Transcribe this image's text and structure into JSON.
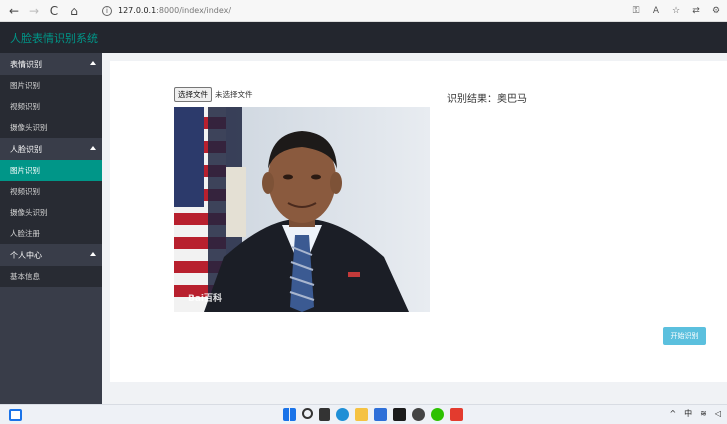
{
  "browser": {
    "url_host": "127.0.0.1",
    "url_path": ":8000/index/index/",
    "back_icon": "←",
    "forward_icon": "→",
    "reload_icon": "C",
    "home_icon": "⌂"
  },
  "header": {
    "title": "人脸表情识别系统"
  },
  "sidebar": {
    "groups": [
      {
        "label": "表情识别",
        "items": [
          "图片识别",
          "视频识别",
          "摄像头识别"
        ]
      },
      {
        "label": "人脸识别",
        "items": [
          "图片识别",
          "视频识别",
          "摄像头识别",
          "人脸注册"
        ]
      },
      {
        "label": "个人中心",
        "items": [
          "基本信息"
        ]
      }
    ]
  },
  "main": {
    "file_button_label": "选择文件",
    "file_status": "未选择文件",
    "result_label": "识别结果：",
    "result_value": "奥巴马",
    "watermark": "Bai百科",
    "start_button": "开始识别"
  },
  "taskbar": {
    "tray_lang": "中"
  },
  "colors": {
    "header_bg": "#23262e",
    "sidebar_bg": "#393d49",
    "accent": "#009688",
    "button": "#5bc0de"
  }
}
